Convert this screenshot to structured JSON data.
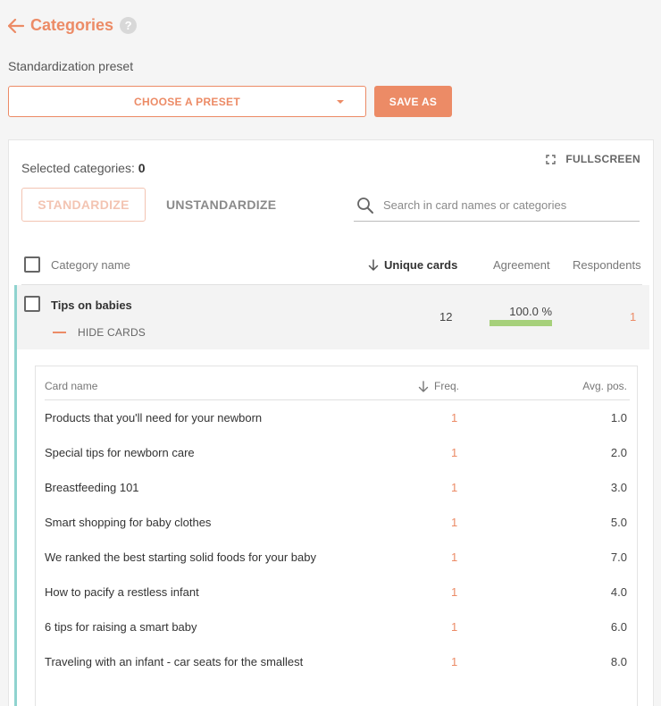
{
  "header": {
    "title": "Categories",
    "help_symbol": "?"
  },
  "preset": {
    "label": "Standardization preset",
    "select_value": "CHOOSE A PRESET",
    "save_as_label": "SAVE AS"
  },
  "panel": {
    "fullscreen_label": "FULLSCREEN",
    "selected_label": "Selected categories:",
    "selected_count": "0",
    "standardize_label": "STANDARDIZE",
    "unstandardize_label": "UNSTANDARDIZE",
    "search_placeholder": "Search in card names or categories"
  },
  "table": {
    "headers": {
      "category_name": "Category name",
      "unique_cards": "Unique cards",
      "agreement": "Agreement",
      "respondents": "Respondents"
    },
    "category": {
      "name": "Tips on babies",
      "hide_cards_label": "HIDE CARDS",
      "unique_cards": "12",
      "agreement_text": "100.0 %",
      "agreement_fraction": 1.0,
      "respondents": "1"
    }
  },
  "cards": {
    "headers": {
      "name": "Card name",
      "freq": "Freq.",
      "avg_pos": "Avg. pos."
    },
    "rows": [
      {
        "name": "Products that you'll need for your newborn",
        "freq": "1",
        "avg": "1.0"
      },
      {
        "name": "Special tips for newborn care",
        "freq": "1",
        "avg": "2.0"
      },
      {
        "name": "Breastfeeding 101",
        "freq": "1",
        "avg": "3.0"
      },
      {
        "name": "Smart shopping for baby clothes",
        "freq": "1",
        "avg": "5.0"
      },
      {
        "name": "We ranked the best starting solid foods for your baby",
        "freq": "1",
        "avg": "7.0"
      },
      {
        "name": "How to pacify a restless infant",
        "freq": "1",
        "avg": "4.0"
      },
      {
        "name": "6 tips for raising a smart baby",
        "freq": "1",
        "avg": "6.0"
      },
      {
        "name": "Traveling with an infant - car seats for the smallest",
        "freq": "1",
        "avg": "8.0"
      }
    ]
  },
  "colors": {
    "accent": "#ec8b66",
    "teal": "#8fd3cf",
    "agreement_bar": "#a6d07a"
  }
}
